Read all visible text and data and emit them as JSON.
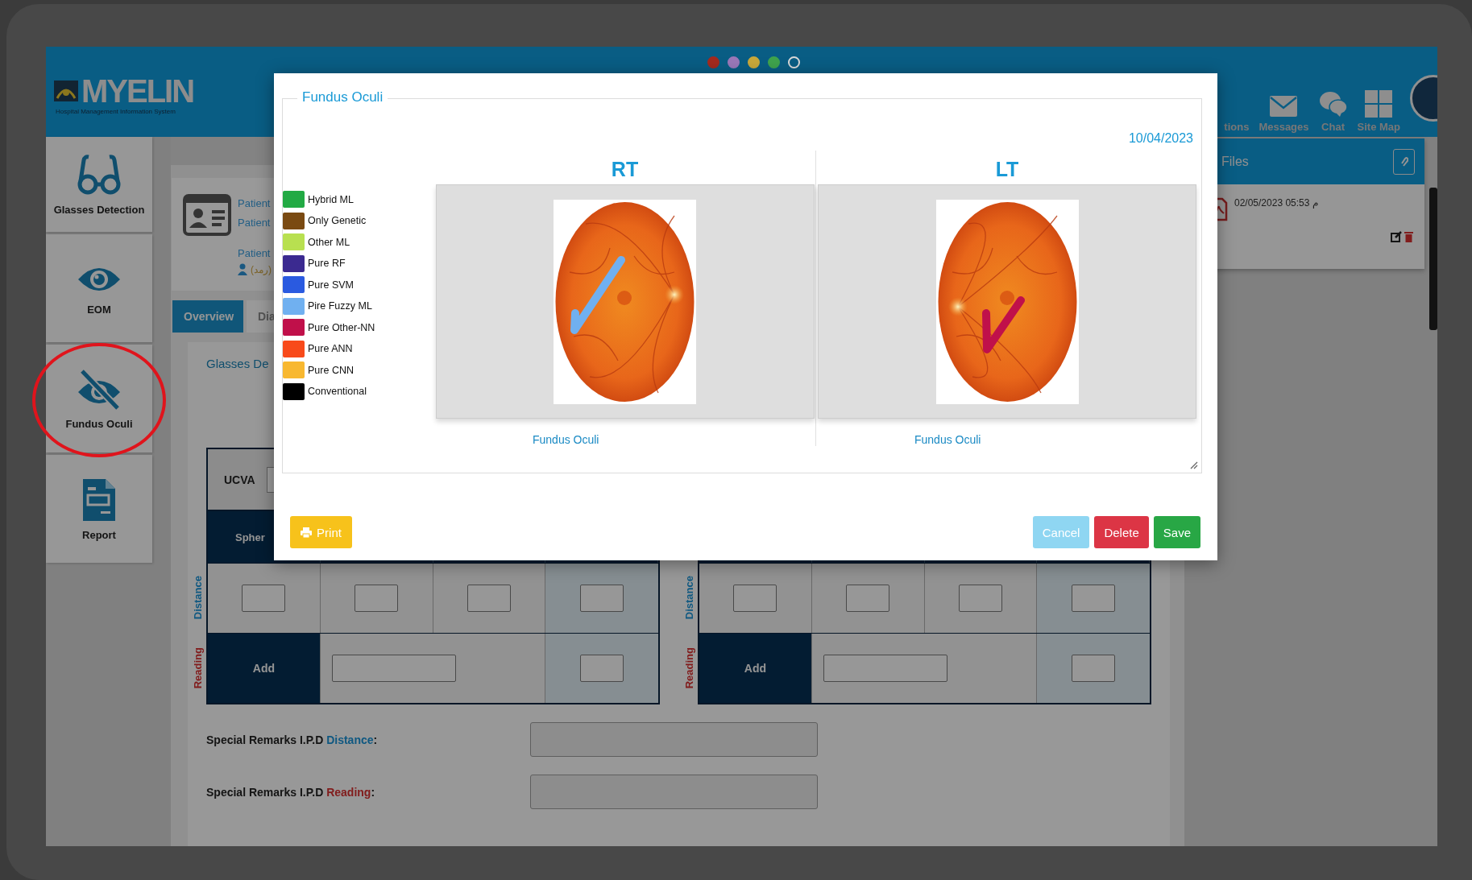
{
  "frame_dots": [
    {
      "color": "#a32a1f",
      "filled": true
    },
    {
      "color": "#9a78b8",
      "filled": true
    },
    {
      "color": "#c9a83a",
      "filled": true
    },
    {
      "color": "#3fa34d",
      "filled": true
    },
    {
      "color": "#d8d8d8",
      "filled": false
    }
  ],
  "header": {
    "logo": "MYELIN",
    "logo_subtitle": "Hospital Management Information System",
    "nav": [
      {
        "label": "tions"
      },
      {
        "label": "Messages"
      },
      {
        "label": "Chat"
      },
      {
        "label": "Site Map"
      }
    ]
  },
  "sidebar": {
    "items": [
      {
        "label": "Glasses Detection",
        "circled": false
      },
      {
        "label": "EOM",
        "circled": false
      },
      {
        "label": "Fundus Oculi",
        "circled": true
      },
      {
        "label": "Report",
        "circled": false
      }
    ]
  },
  "patient_card": {
    "lines": [
      "Patient",
      "Patient",
      "Patient"
    ],
    "department": "(رمد)"
  },
  "tabs": [
    {
      "label": "Overview",
      "selected": true
    },
    {
      "label": "Dia",
      "selected": false
    }
  ],
  "section_title": "Glasses De",
  "ucva_label": "UCVA",
  "tables": [
    {
      "header": "Spher",
      "rows": [
        {
          "kind": "distance",
          "label": "Distance"
        },
        {
          "kind": "reading",
          "label": "Reading",
          "cell": "Add"
        }
      ]
    },
    {
      "rows": [
        {
          "kind": "distance",
          "label": "Distance"
        },
        {
          "kind": "reading",
          "label": "Reading",
          "cell": "Add"
        }
      ]
    }
  ],
  "remarks": [
    {
      "kind": "distance",
      "prefix": "Special Remarks I.P.D",
      "term": "Distance",
      "suffix": ":"
    },
    {
      "kind": "reading",
      "prefix": "Special Remarks I.P.D",
      "term": "Reading",
      "suffix": ":"
    }
  ],
  "files": {
    "title": "Files",
    "items": [
      {
        "date": "02/05/2023 05:53 م"
      }
    ]
  },
  "modal": {
    "legend": "Fundus Oculi",
    "date": "10/04/2023",
    "color_key": [
      {
        "label": "Hybrid ML",
        "color": "#22aa44"
      },
      {
        "label": "Only Genetic",
        "color": "#7a4a12"
      },
      {
        "label": "Other ML",
        "color": "#b8e050"
      },
      {
        "label": "Pure RF",
        "color": "#3b2a90"
      },
      {
        "label": "Pure SVM",
        "color": "#2a5ae0"
      },
      {
        "label": "Pire Fuzzy ML",
        "color": "#70b0f0"
      },
      {
        "label": "Pure Other-NN",
        "color": "#c0104a"
      },
      {
        "label": "Pure ANN",
        "color": "#f84a1a"
      },
      {
        "label": "Pure CNN",
        "color": "#f8b830"
      },
      {
        "label": "Conventional",
        "color": "#000000"
      }
    ],
    "eyes": [
      {
        "label": "RT",
        "caption": "Fundus Oculi",
        "color": "#70b0f0"
      },
      {
        "label": "LT",
        "caption": "Fundus Oculi",
        "color": "#c0104a"
      }
    ],
    "buttons": [
      {
        "label": "Print",
        "kind": "print"
      },
      {
        "label": "Cancel",
        "kind": "cancel"
      },
      {
        "label": "Delete",
        "kind": "delete"
      },
      {
        "label": "Save",
        "kind": "save"
      }
    ]
  }
}
